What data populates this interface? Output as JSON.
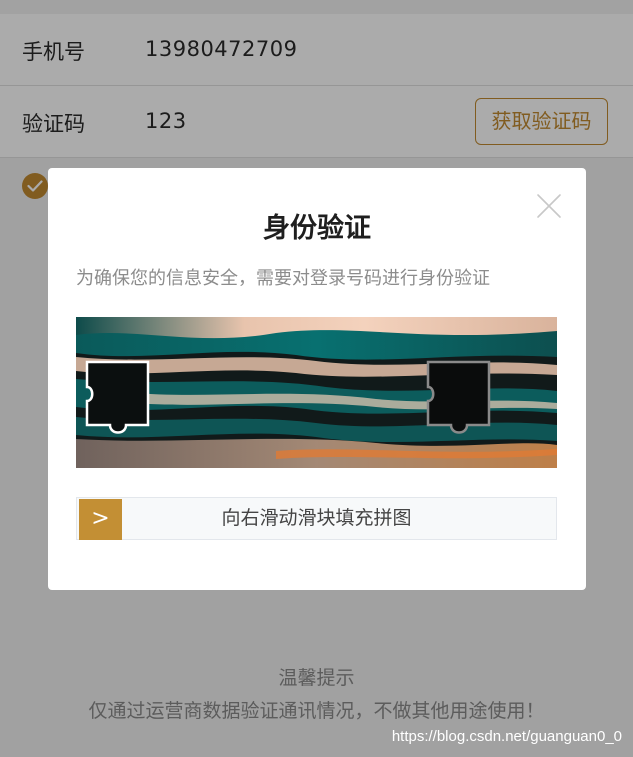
{
  "form": {
    "phone_label": "手机号",
    "phone_value": "13980472709",
    "code_label": "验证码",
    "code_value": "123",
    "get_code_button": "获取验证码"
  },
  "tips": {
    "title": "温馨提示",
    "text": "仅通过运营商数据验证通讯情况，不做其他用途使用！"
  },
  "watermark": "https://blog.csdn.net/guanguan0_0",
  "dialog": {
    "title": "身份验证",
    "description": "为确保您的信息安全，需要对登录号码进行身份验证",
    "slider_handle_glyph": ">",
    "slider_text": "向右滑动滑块填充拼图"
  },
  "colors": {
    "accent": "#c08a31",
    "slider_handle": "#c38f34",
    "overlay": "rgba(0,0,0,0.33)"
  },
  "icons": {
    "close": "close-icon",
    "check": "checkmark-icon"
  }
}
